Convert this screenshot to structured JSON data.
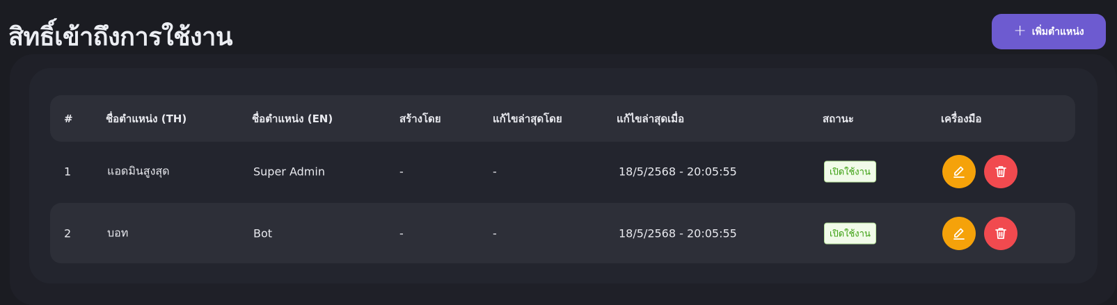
{
  "header": {
    "title": "สิทธิ์เข้าถึงการใช้งาน",
    "add_button_label": "เพิ่มตำแหน่ง",
    "add_icon": "plus-icon"
  },
  "table": {
    "columns": [
      "#",
      "ชื่อตำแหน่ง (TH)",
      "ชื่อตำแหน่ง (EN)",
      "สร้างโดย",
      "แก้ไขล่าสุดโดย",
      "แก้ไขล่าสุดเมื่อ",
      "สถานะ",
      "เครื่องมือ"
    ],
    "rows": [
      {
        "num": "1",
        "name_th": "แอดมินสูงสุด",
        "name_en": "Super Admin",
        "created_by": "-",
        "edited_by": "-",
        "edited_at": "18/5/2568 - 20:05:55",
        "status": "เปิดใช้งาน"
      },
      {
        "num": "2",
        "name_th": "บอท",
        "name_en": "Bot",
        "created_by": "-",
        "edited_by": "-",
        "edited_at": "18/5/2568 - 20:05:55",
        "status": "เปิดใช้งาน"
      }
    ],
    "tool_icons": [
      "pencil-icon",
      "trash-icon"
    ]
  },
  "colors": {
    "background": "#1b1c22",
    "card": "#23252e",
    "row_alt": "#2d2f38",
    "accent": "#6d5bd0",
    "edit": "#f5a20a",
    "delete": "#f14a4f",
    "status_text": "#389e0d"
  }
}
